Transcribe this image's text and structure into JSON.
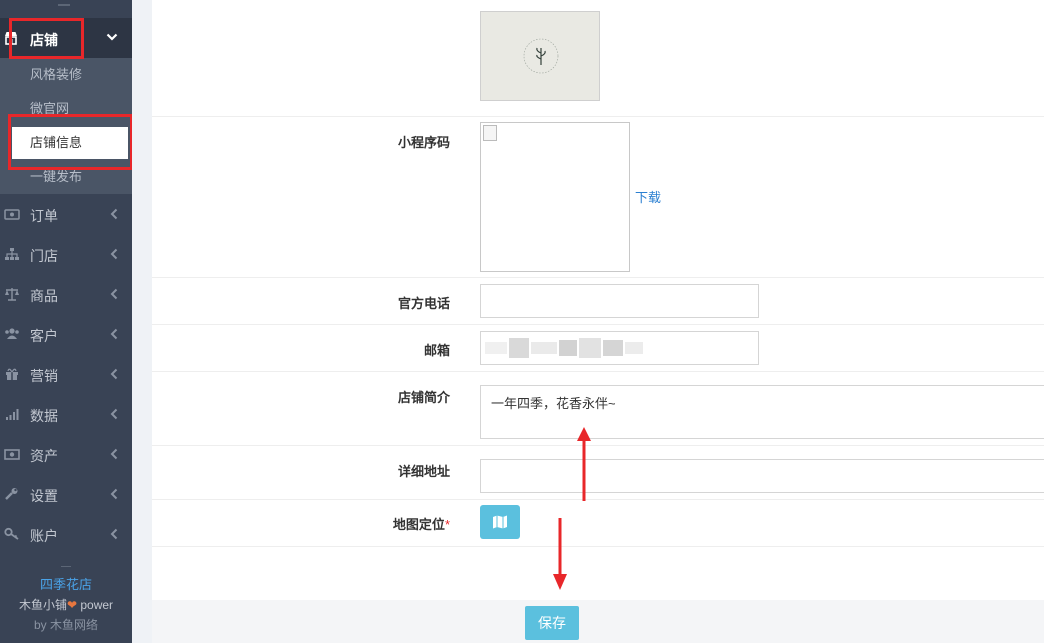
{
  "sidebar": {
    "main_item": {
      "label": "店铺",
      "icon": "shop-icon"
    },
    "submenu": [
      {
        "label": "风格装修",
        "active": false
      },
      {
        "label": "微官网",
        "active": false
      },
      {
        "label": "店铺信息",
        "active": true
      },
      {
        "label": "一键发布",
        "active": false
      }
    ],
    "items": [
      {
        "label": "订单",
        "icon": "money-icon"
      },
      {
        "label": "门店",
        "icon": "sitemap-icon"
      },
      {
        "label": "商品",
        "icon": "scale-icon"
      },
      {
        "label": "客户",
        "icon": "users-icon"
      },
      {
        "label": "营销",
        "icon": "gift-icon"
      },
      {
        "label": "数据",
        "icon": "signal-icon"
      },
      {
        "label": "资产",
        "icon": "cash-icon"
      },
      {
        "label": "设置",
        "icon": "wrench-icon"
      },
      {
        "label": "账户",
        "icon": "key-icon"
      }
    ],
    "footer": {
      "shop_name": "四季花店",
      "powered_prefix": "木鱼小铺",
      "powered_suffix": " power",
      "by_text": "by 木鱼网络"
    }
  },
  "form": {
    "miniprogram_label": "小程序码",
    "download_label": "下载",
    "phone_label": "官方电话",
    "phone_value": "",
    "email_label": "邮箱",
    "intro_label": "店铺简介",
    "intro_value": "一年四季，花香永伴~",
    "address_label": "详细地址",
    "address_value": "",
    "map_label": "地图定位",
    "required_mark": "*",
    "save_label": "保存"
  },
  "colors": {
    "sidebar_bg": "#394355",
    "accent": "#5bc0de",
    "highlight_red": "#e8272a",
    "link_blue": "#2a7fd1"
  }
}
